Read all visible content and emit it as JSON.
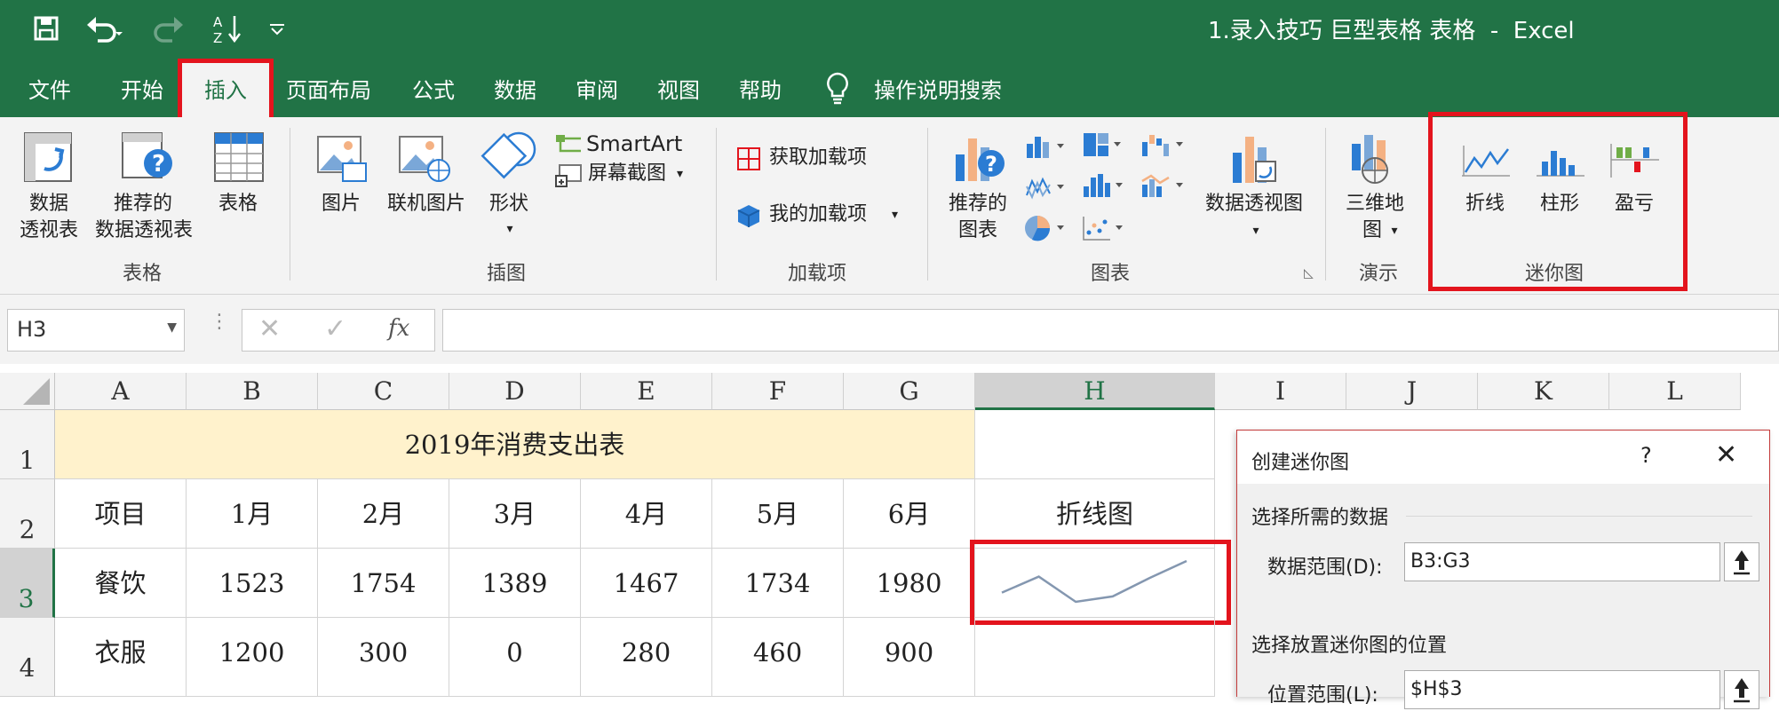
{
  "window": {
    "title": "1.录入技巧 巨型表格 表格  -  Excel"
  },
  "tabs": [
    "文件",
    "开始",
    "插入",
    "页面布局",
    "公式",
    "数据",
    "审阅",
    "视图",
    "帮助"
  ],
  "tell_me": "操作说明搜索",
  "ribbon": {
    "tables": {
      "pivot": [
        "数据",
        "透视表"
      ],
      "recommended_pivot": [
        "推荐的",
        "数据透视表"
      ],
      "table": "表格",
      "group": "表格"
    },
    "illustrations": {
      "pictures": "图片",
      "online_pictures": "联机图片",
      "shapes": "形状",
      "smartart": "SmartArt",
      "screenshot": "屏幕截图",
      "group": "插图"
    },
    "addins": {
      "get": "获取加载项",
      "my": "我的加载项",
      "group": "加载项"
    },
    "charts": {
      "recommended": [
        "推荐的",
        "图表"
      ],
      "pivot_chart": "数据透视图",
      "group": "图表"
    },
    "tours": {
      "map3d": [
        "三维地",
        "图"
      ],
      "group": "演示"
    },
    "sparklines": {
      "line": "折线",
      "column": "柱形",
      "winloss": "盈亏",
      "group": "迷你图"
    }
  },
  "formula_bar": {
    "name_box": "H3",
    "formula": ""
  },
  "columns": [
    "A",
    "B",
    "C",
    "D",
    "E",
    "F",
    "G",
    "H",
    "I",
    "J",
    "K",
    "L"
  ],
  "rows": [
    "1",
    "2",
    "3",
    "4"
  ],
  "sheet": {
    "title": "2019年消费支出表",
    "header": [
      "项目",
      "1月",
      "2月",
      "3月",
      "4月",
      "5月",
      "6月"
    ],
    "h2": "折线图",
    "data": [
      [
        "餐饮",
        "1523",
        "1754",
        "1389",
        "1467",
        "1734",
        "1980"
      ],
      [
        "衣服",
        "1200",
        "300",
        "0",
        "280",
        "460",
        "900"
      ]
    ],
    "sparkline_values": [
      1523,
      1754,
      1389,
      1467,
      1734,
      1980
    ]
  },
  "dialog": {
    "title": "创建迷你图",
    "help": "?",
    "section1": "选择所需的数据",
    "data_range_label": "数据范围(D):",
    "data_range_value": "B3:G3",
    "section2": "选择放置迷你图的位置",
    "location_label": "位置范围(L):",
    "location_value": "$H$3"
  },
  "colors": {
    "excel_green": "#217346",
    "highlight_red": "#e3141d",
    "title_fill": "#fff2cc"
  }
}
